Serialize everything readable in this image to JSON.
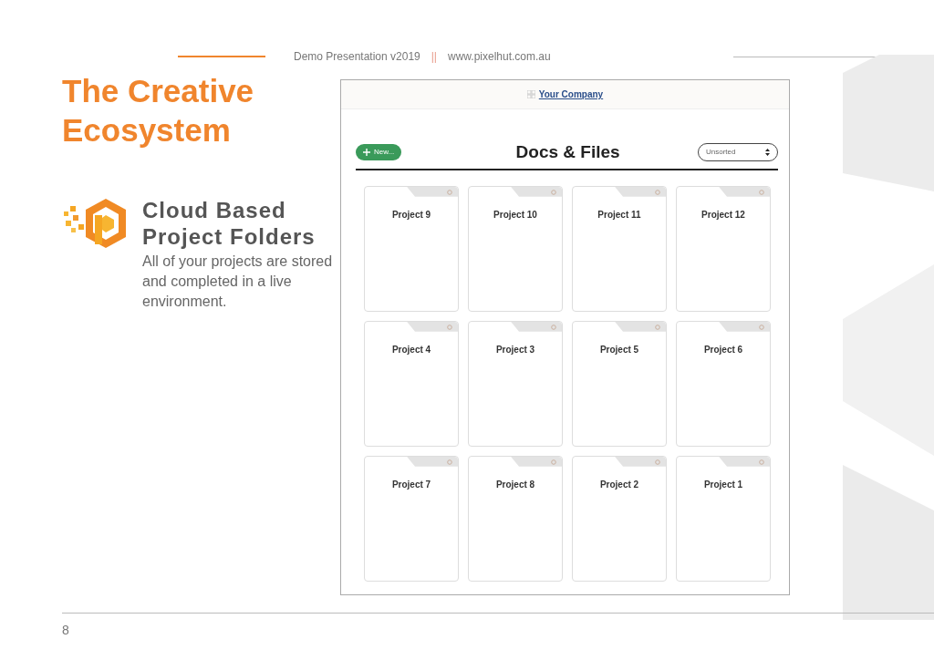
{
  "header": {
    "title": "Demo Presentation  v2019",
    "separator": "||",
    "website": "www.pixelhut.com.au"
  },
  "heading": "The Creative Ecosystem",
  "feature": {
    "title": "Cloud Based Project Folders",
    "description": "All of your projects are stored and completed in a live environment."
  },
  "app": {
    "company": "Your Company",
    "new_button": "New...",
    "title": "Docs & Files",
    "sort": {
      "value": "Unsorted"
    },
    "folders": [
      {
        "name": "Project 9"
      },
      {
        "name": "Project 10"
      },
      {
        "name": "Project 11"
      },
      {
        "name": "Project 12"
      },
      {
        "name": "Project 4"
      },
      {
        "name": "Project 3"
      },
      {
        "name": "Project 5"
      },
      {
        "name": "Project 6"
      },
      {
        "name": "Project 7"
      },
      {
        "name": "Project 8"
      },
      {
        "name": "Project 2"
      },
      {
        "name": "Project 1"
      }
    ]
  },
  "page_number": "8"
}
